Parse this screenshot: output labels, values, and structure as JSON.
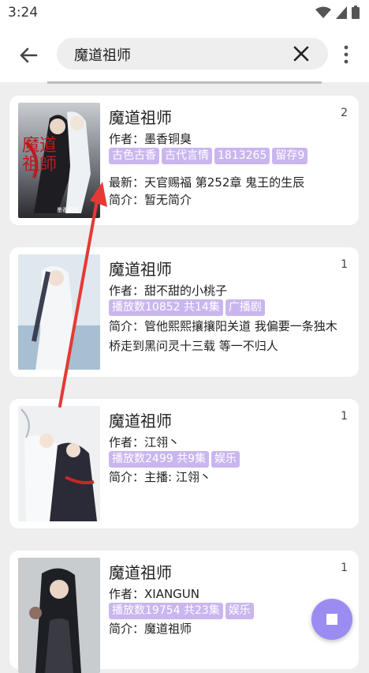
{
  "status": {
    "time": "3:24"
  },
  "search": {
    "query": "魔道祖师"
  },
  "results": [
    {
      "title": "魔道祖师",
      "count": "2",
      "author": "作者：墨香铜臭",
      "tags": [
        "古色古香",
        "古代言情",
        "1813265",
        "留存9"
      ],
      "latest": "最新：天官赐福 第252章 鬼王的生辰",
      "intro": "简介：暂无简介",
      "cover_text": "魔道祖師",
      "cover_author": "墨香铜臭"
    },
    {
      "title": "魔道祖师",
      "count": "1",
      "author": "作者：甜不甜的小桃子",
      "tags": [
        "播放数10852 共14集",
        "广播剧"
      ],
      "intro": "简介：管他熙熙攘攘阳关道 我偏要一条独木桥走到黑问灵十三载 等一不归人"
    },
    {
      "title": "魔道祖师",
      "count": "1",
      "author": "作者：江翎丶",
      "tags": [
        "播放数2499 共9集",
        "娱乐"
      ],
      "intro": "简介：主播: 江翎丶"
    },
    {
      "title": "魔道祖师",
      "count": "1",
      "author": "作者：XIANGUN",
      "tags": [
        "播放数19754 共23集",
        "娱乐"
      ],
      "intro": "简介：魔道祖师"
    }
  ]
}
